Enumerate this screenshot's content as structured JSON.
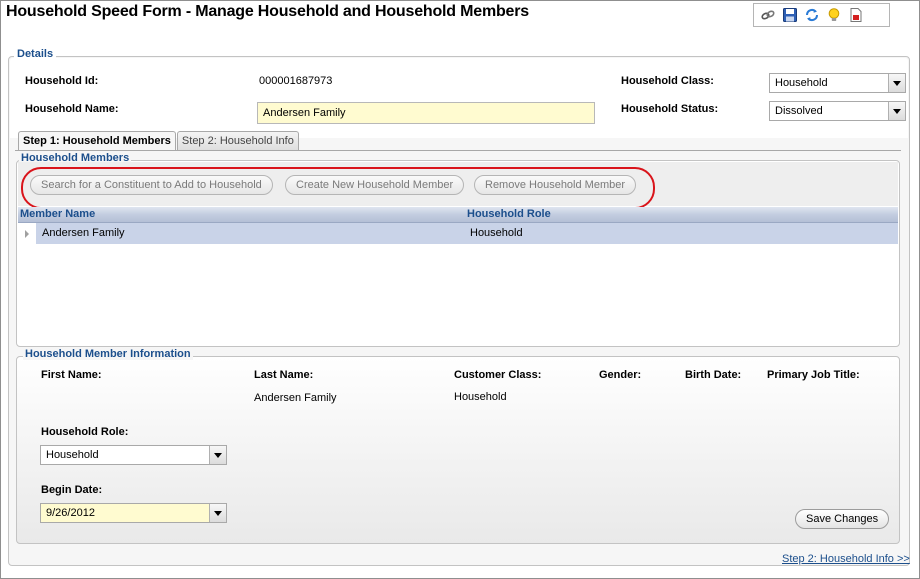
{
  "window": {
    "title": "Household Speed Form - Manage Household and Household Members"
  },
  "toolbar": {
    "icons": [
      "link-icon",
      "save-icon",
      "refresh-icon",
      "lightbulb-icon",
      "report-icon"
    ]
  },
  "details": {
    "legend": "Details",
    "household_id_label": "Household Id:",
    "household_id_value": "000001687973",
    "household_name_label": "Household Name:",
    "household_name_value": "Andersen Family",
    "household_class_label": "Household Class:",
    "household_class_value": "Household",
    "household_status_label": "Household Status:",
    "household_status_value": "Dissolved"
  },
  "tabs": [
    {
      "label": "Step 1: Household Members",
      "active": true
    },
    {
      "label": "Step 2: Household Info",
      "active": false
    }
  ],
  "members": {
    "legend": "Household Members",
    "buttons": {
      "search": "Search for a Constituent to Add to Household",
      "create": "Create New Household Member",
      "remove": "Remove Household Member"
    },
    "columns": [
      "Member Name",
      "Household Role"
    ],
    "rows": [
      {
        "member_name": "Andersen Family",
        "household_role": "Household"
      }
    ]
  },
  "info": {
    "legend": "Household Member Information",
    "first_name_label": "First Name:",
    "last_name_label": "Last Name:",
    "last_name_value": "Andersen Family",
    "customer_class_label": "Customer Class:",
    "customer_class_value": "Household",
    "gender_label": "Gender:",
    "birth_date_label": "Birth Date:",
    "primary_job_title_label": "Primary Job Title:",
    "household_role_label": "Household Role:",
    "household_role_value": "Household",
    "begin_date_label": "Begin Date:",
    "begin_date_value": "9/26/2012",
    "save_button": "Save Changes"
  },
  "footer": {
    "next_link": "Step 2: Household Info >>"
  },
  "colors": {
    "accent": "#1c4f8c",
    "highlight_ring": "#d9141b",
    "required_field": "#fffbd0",
    "selected_row": "#c9d3e8"
  }
}
